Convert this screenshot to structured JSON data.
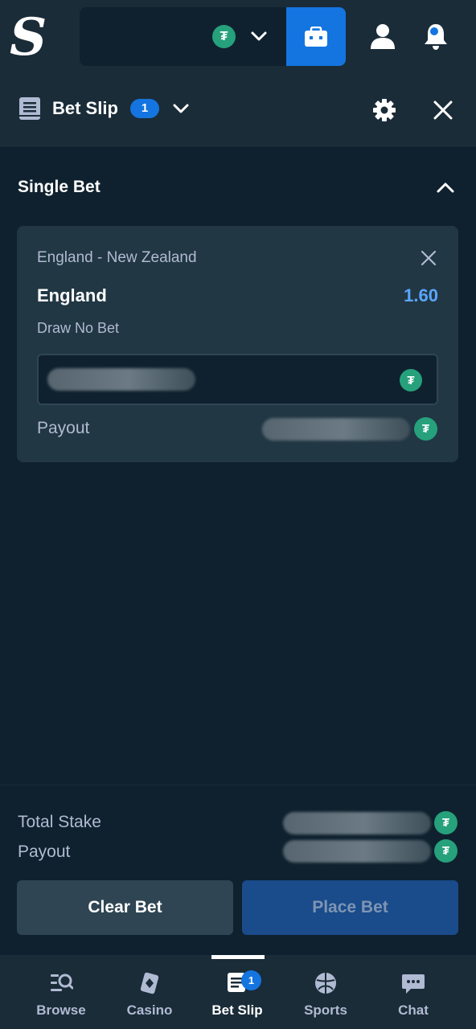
{
  "header": {
    "logo_letter": "S",
    "currency_symbol": "₮"
  },
  "bet_slip": {
    "title": "Bet Slip",
    "count": "1"
  },
  "section": {
    "title": "Single Bet"
  },
  "bet": {
    "match": "England - New Zealand",
    "selection": "England",
    "odds": "1.60",
    "market": "Draw No Bet",
    "payout_label": "Payout"
  },
  "footer": {
    "total_stake_label": "Total Stake",
    "payout_label": "Payout",
    "clear_button": "Clear Bet",
    "place_button": "Place Bet"
  },
  "nav": {
    "items": [
      {
        "label": "Browse",
        "icon": "browse-icon"
      },
      {
        "label": "Casino",
        "icon": "casino-icon"
      },
      {
        "label": "Bet Slip",
        "icon": "bet-slip-icon",
        "active": true,
        "badge": "1"
      },
      {
        "label": "Sports",
        "icon": "sports-icon"
      },
      {
        "label": "Chat",
        "icon": "chat-icon"
      }
    ]
  },
  "colors": {
    "background": "#0f212e",
    "panel": "#1a2c38",
    "card": "#213743",
    "accent_blue": "#1475e1",
    "odds_blue": "#5aa6ff",
    "usdt_green": "#26a17b"
  }
}
